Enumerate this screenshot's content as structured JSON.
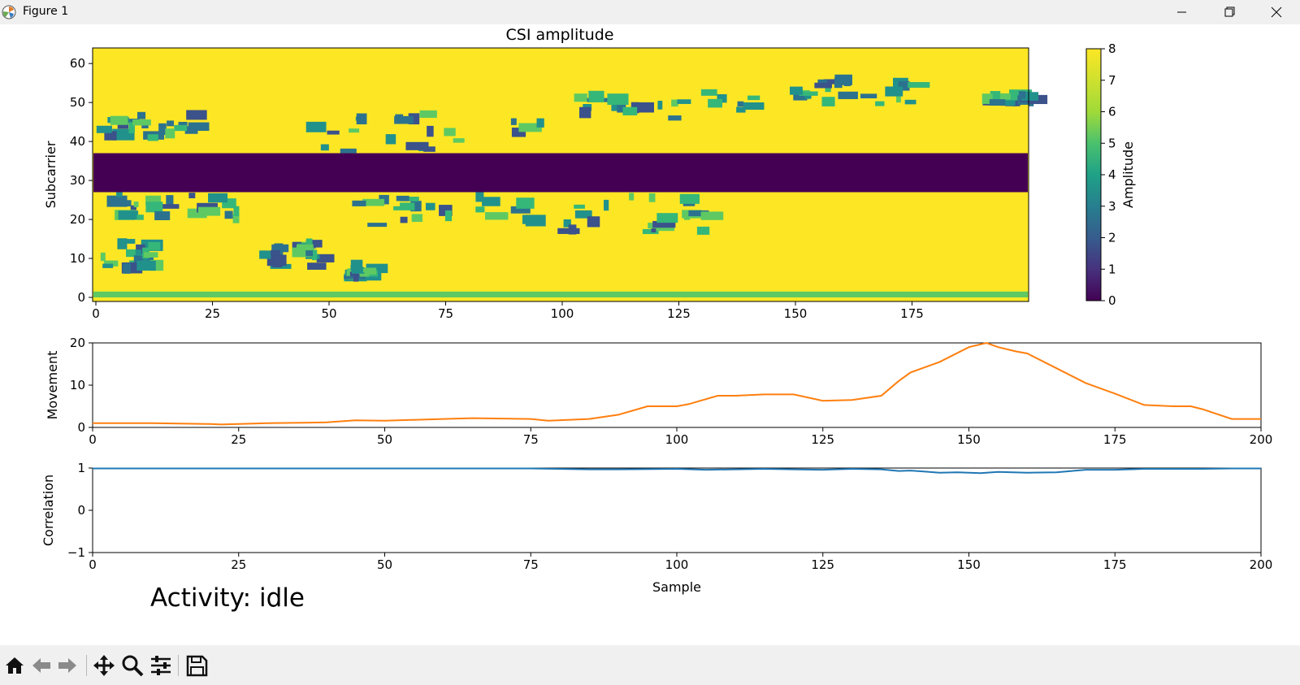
{
  "window": {
    "title": "Figure 1",
    "icon": "matplotlib-logo-icon",
    "controls": [
      "minimize-icon",
      "restore-icon",
      "close-icon"
    ]
  },
  "figure": {
    "title": "CSI amplitude",
    "activity_text": "Activity: idle",
    "colors": {
      "heat_yellow": "#fde725",
      "heat_dark": "#440154",
      "movement_line": "#ff7f0e",
      "correlation_line": "#1f77b4"
    }
  },
  "chart_data": [
    {
      "type": "heatmap",
      "title": "CSI amplitude",
      "xlabel": "",
      "ylabel": "Subcarrier",
      "x_range": [
        0,
        200
      ],
      "y_range": [
        0,
        64
      ],
      "xticks": [
        0,
        25,
        50,
        75,
        100,
        125,
        150,
        175
      ],
      "yticks": [
        0,
        10,
        20,
        30,
        40,
        50,
        60
      ],
      "colormap": "viridis",
      "colorbar": {
        "label": "Amplitude",
        "range": [
          0,
          8
        ],
        "ticks": [
          0,
          1,
          2,
          3,
          4,
          5,
          6,
          7,
          8
        ]
      },
      "bands": [
        {
          "description": "low-amplitude band",
          "y_from": 27,
          "y_to": 37,
          "value": 0
        }
      ],
      "background_value": 8
    },
    {
      "type": "line",
      "ylabel": "Movement",
      "xlim": [
        0,
        200
      ],
      "ylim": [
        0,
        20
      ],
      "xticks": [
        0,
        25,
        50,
        75,
        100,
        125,
        150,
        175,
        200
      ],
      "yticks": [
        0,
        10,
        20
      ],
      "series": [
        {
          "x": [
            0,
            10,
            20,
            22,
            30,
            40,
            45,
            50,
            60,
            65,
            75,
            78,
            85,
            90,
            95,
            100,
            102,
            107,
            110,
            115,
            120,
            125,
            130,
            135,
            138,
            140,
            145,
            150,
            153,
            155,
            158,
            160,
            165,
            170,
            175,
            180,
            185,
            188,
            190,
            195,
            200
          ],
          "y": [
            1,
            1,
            0.8,
            0.7,
            1,
            1.2,
            1.7,
            1.6,
            2,
            2.2,
            2,
            1.6,
            2,
            3,
            5,
            5,
            5.5,
            7.5,
            7.5,
            7.8,
            7.8,
            6.3,
            6.5,
            7.5,
            11,
            13,
            15.5,
            19,
            21,
            19,
            18,
            17.5,
            14,
            10.5,
            8,
            5.3,
            5,
            5,
            4.3,
            2,
            2
          ]
        }
      ]
    },
    {
      "type": "line",
      "xlabel": "Sample",
      "ylabel": "Correlation",
      "xlim": [
        0,
        200
      ],
      "ylim": [
        -1,
        1
      ],
      "xticks": [
        0,
        25,
        50,
        75,
        100,
        125,
        150,
        175,
        200
      ],
      "yticks": [
        -1,
        0,
        1
      ],
      "series": [
        {
          "x": [
            0,
            25,
            50,
            75,
            85,
            90,
            100,
            105,
            110,
            115,
            120,
            125,
            130,
            135,
            138,
            140,
            145,
            148,
            152,
            155,
            160,
            165,
            170,
            175,
            180,
            190,
            195,
            200
          ],
          "y": [
            0.99,
            0.99,
            0.99,
            0.99,
            0.97,
            0.97,
            0.98,
            0.96,
            0.97,
            0.98,
            0.97,
            0.96,
            0.98,
            0.97,
            0.93,
            0.94,
            0.89,
            0.9,
            0.88,
            0.91,
            0.89,
            0.9,
            0.96,
            0.96,
            0.98,
            0.98,
            0.99,
            0.99
          ]
        }
      ]
    }
  ],
  "toolbar": {
    "buttons": [
      "home-icon",
      "back-icon",
      "forward-icon",
      "pan-icon",
      "zoom-icon",
      "configure-subplots-icon",
      "save-icon"
    ]
  }
}
